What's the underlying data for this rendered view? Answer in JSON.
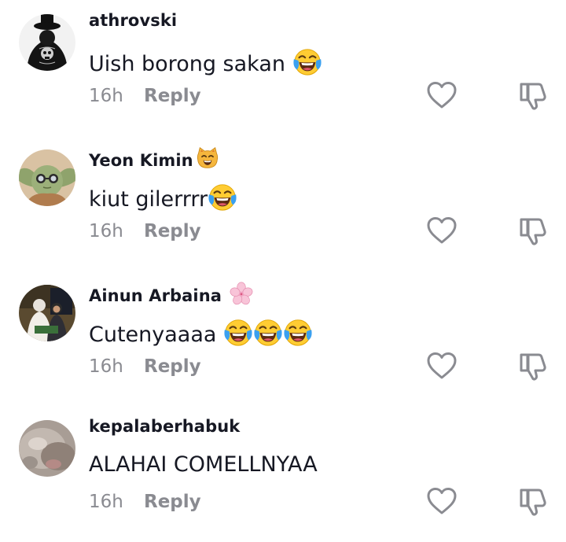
{
  "comments": [
    {
      "username": "athrovski",
      "text": "Uish borong sakan",
      "text_emojis": [
        "face-with-tears-of-joy"
      ],
      "time": "16h",
      "reply_label": "Reply",
      "avatar": "dark-skull-avatar"
    },
    {
      "username": "Yeon Kimin",
      "username_emoji": "cat-face",
      "text": "kiut gilerrrr",
      "text_emojis": [
        "face-with-tears-of-joy"
      ],
      "time": "16h",
      "reply_label": "Reply",
      "avatar": "baby-yoda-glasses-avatar"
    },
    {
      "username": "Ainun Arbaina",
      "username_emoji": "cherry-blossom",
      "text": "Cutenyaaaa",
      "text_emojis": [
        "face-with-tears-of-joy",
        "face-with-tears-of-joy",
        "face-with-tears-of-joy"
      ],
      "time": "16h",
      "reply_label": "Reply",
      "avatar": "two-people-photo-avatar"
    },
    {
      "username": "kepalaberhabuk",
      "text": "ALAHAI COMELLNYAA",
      "text_emojis": [],
      "time": "16h",
      "reply_label": "Reply",
      "avatar": "blurry-cat-avatar"
    }
  ],
  "icons": {
    "like": "heart-outline-icon",
    "dislike": "thumbs-down-outline-icon"
  },
  "colors": {
    "text": "#161823",
    "secondary": "#8a8b91",
    "background": "#ffffff"
  }
}
